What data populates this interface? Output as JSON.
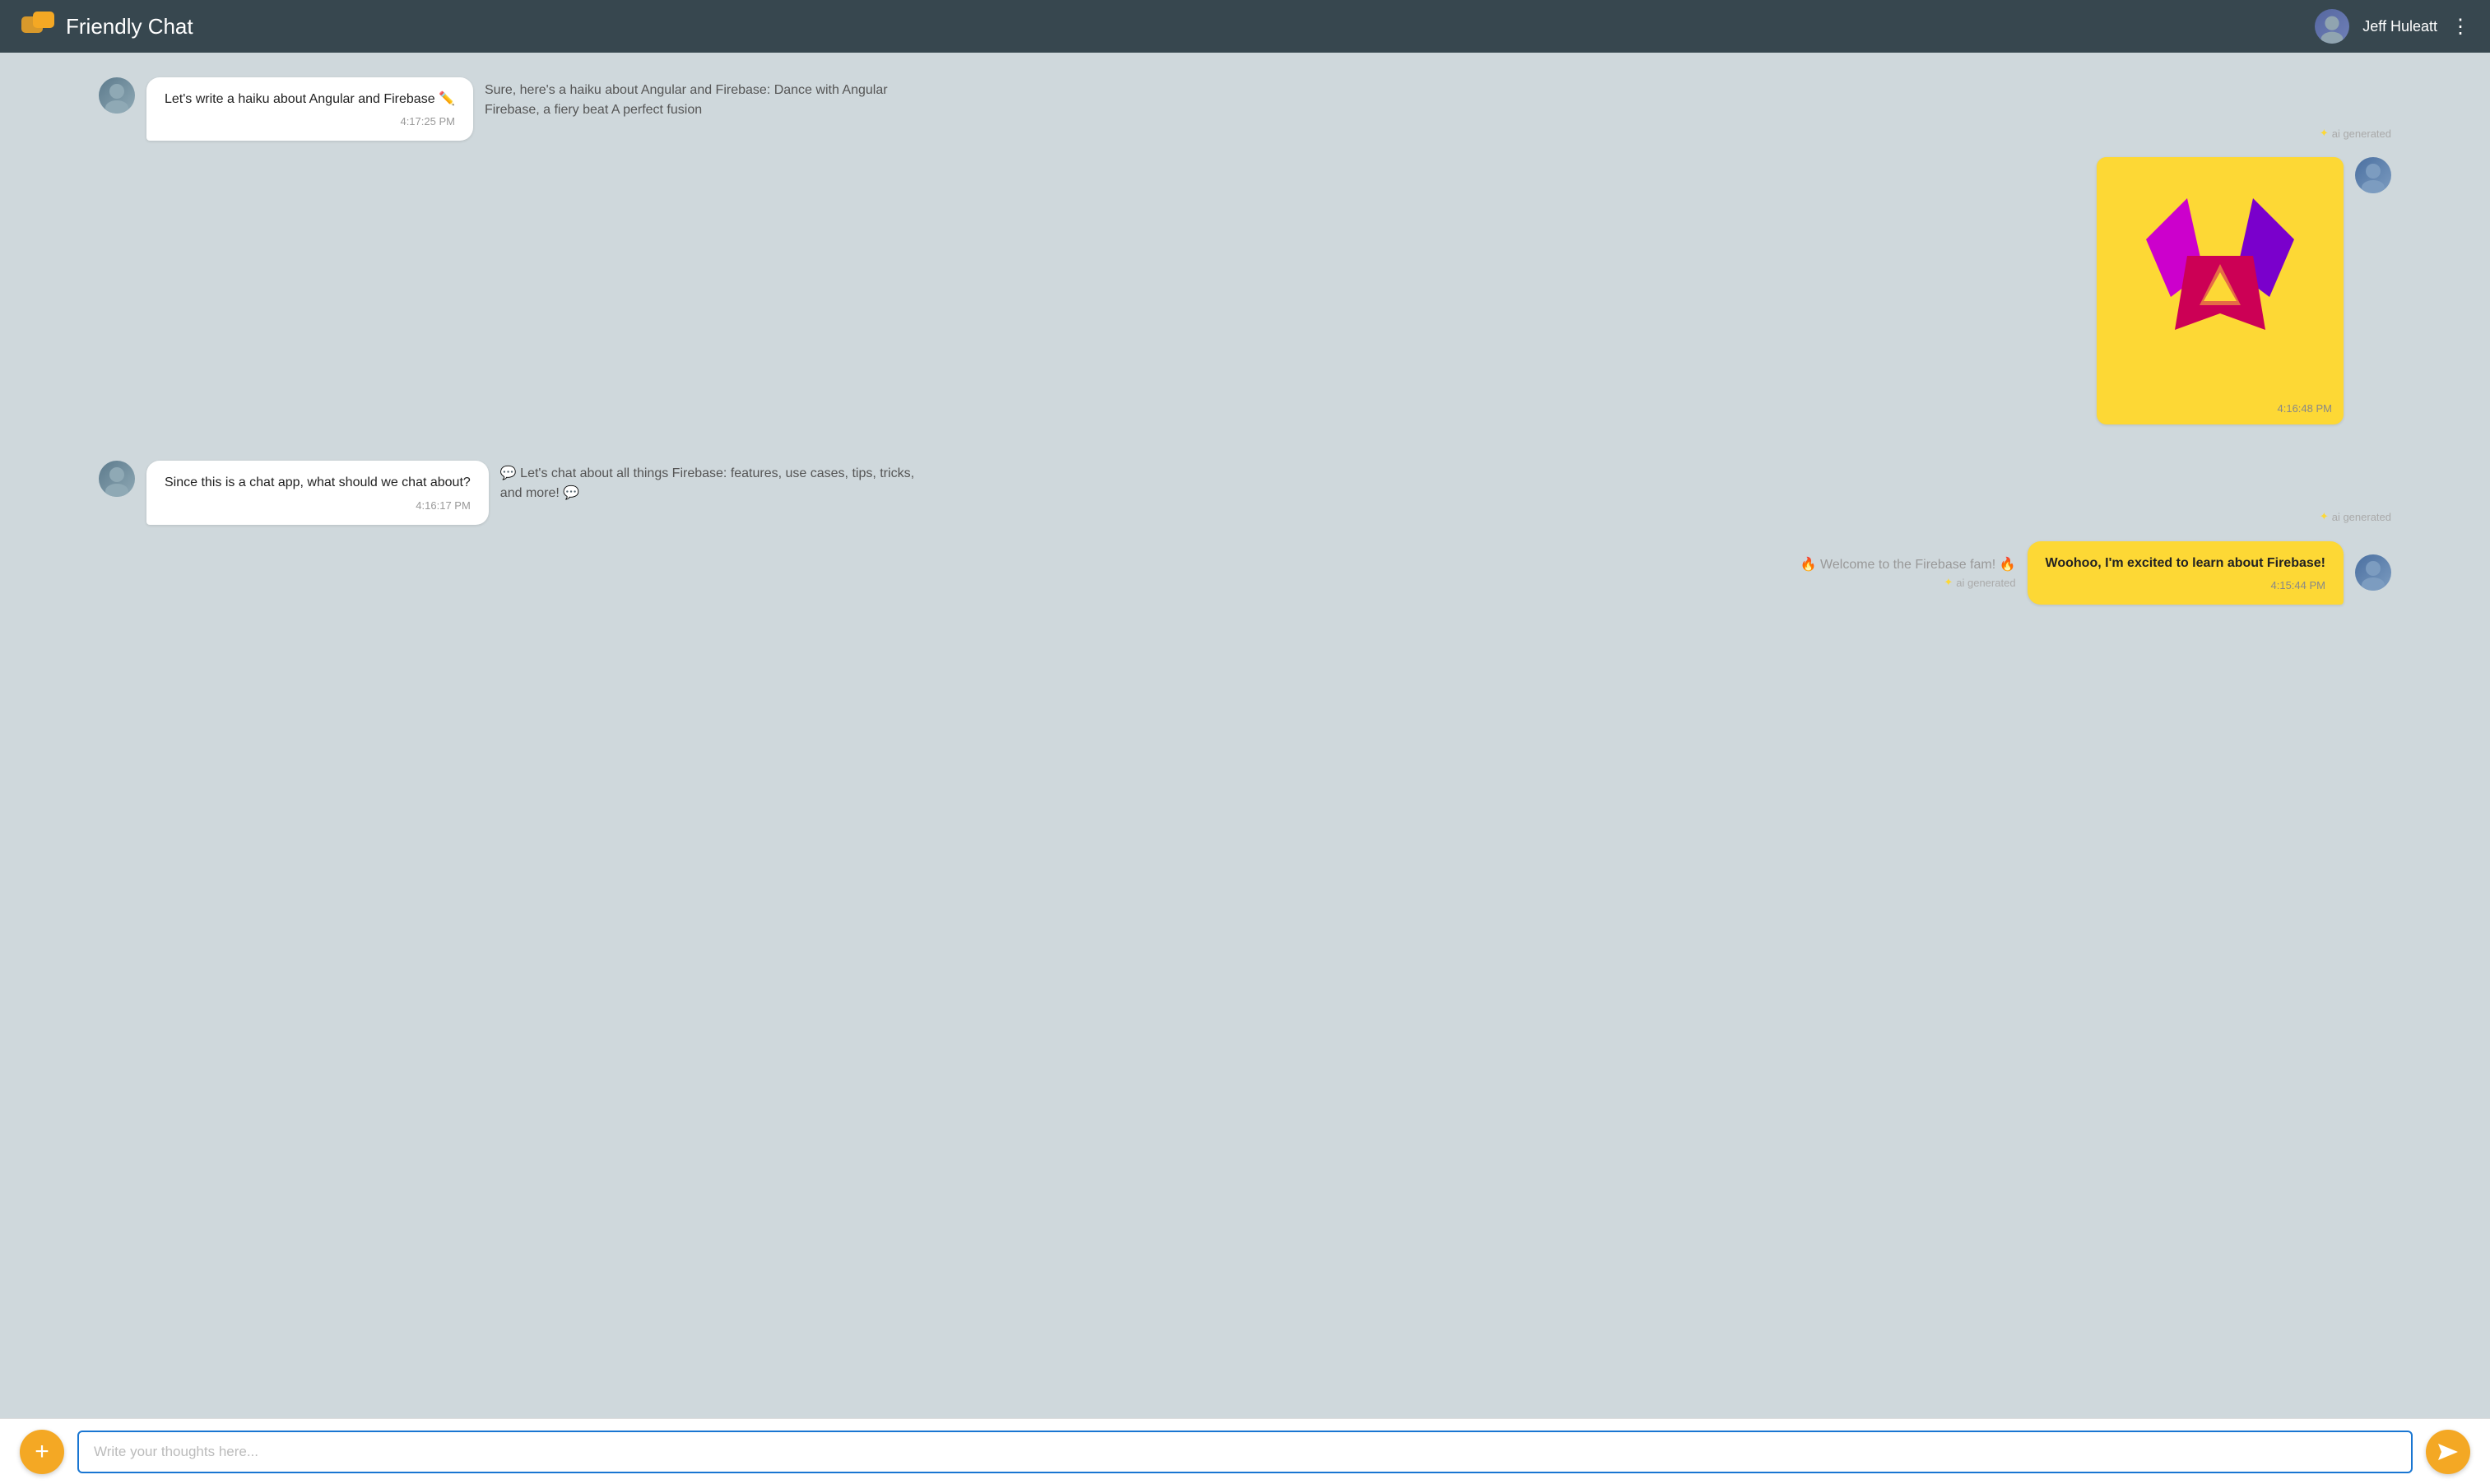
{
  "header": {
    "title": "Friendly Chat",
    "user_name": "Jeff Huleatt",
    "menu_icon": "⋮"
  },
  "messages": [
    {
      "id": "msg1",
      "type": "incoming_with_ai",
      "text": "Let's write a haiku about Angular and Firebase ✏️",
      "time": "4:17:25 PM",
      "ai_text": "Sure, here's a haiku about Angular and Firebase: Dance with Angular Firebase, a fiery beat A perfect fusion",
      "ai_label": "ai generated"
    },
    {
      "id": "msg2",
      "type": "image_outgoing",
      "time": "4:16:48 PM"
    },
    {
      "id": "msg3",
      "type": "incoming_with_ai",
      "text": "Since this is a chat app, what should we chat about?",
      "time": "4:16:17 PM",
      "ai_text": "💬 Let's chat about all things Firebase: features, use cases, tips, tricks, and more! 💬",
      "ai_label": "ai generated"
    },
    {
      "id": "msg4",
      "type": "welcome",
      "ai_text": "🔥 Welcome to the Firebase fam! 🔥",
      "ai_label": "ai generated",
      "outgoing_text": "Woohoo, I'm excited to learn about Firebase!",
      "outgoing_time": "4:15:44 PM"
    }
  ],
  "footer": {
    "add_label": "+",
    "input_placeholder": "Write your thoughts here...",
    "send_icon": ">>",
    "input_value": ""
  }
}
